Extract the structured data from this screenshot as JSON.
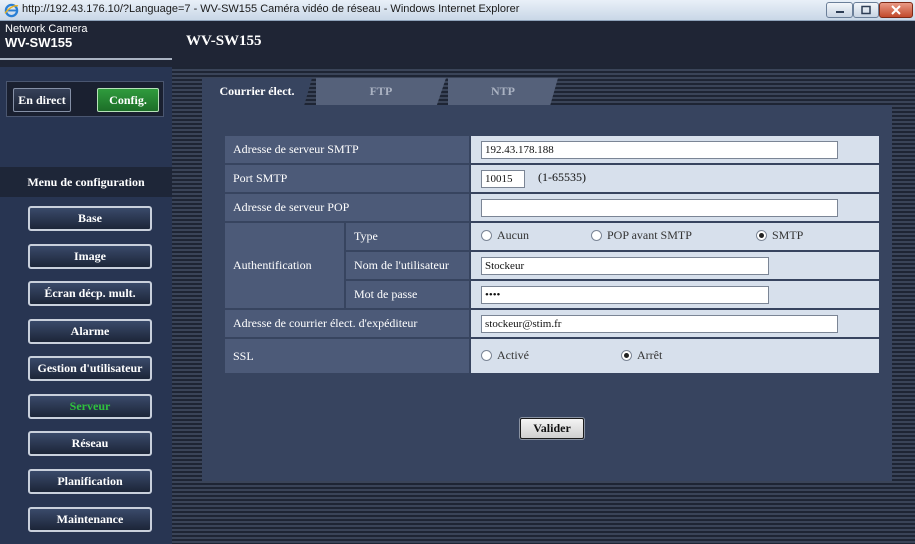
{
  "window": {
    "title": "http://192.43.176.10/?Language=7 - WV-SW155 Caméra vidéo de réseau - Windows Internet Explorer",
    "icons": [
      "ie-icon",
      "minimize-icon",
      "maximize-icon",
      "close-icon"
    ]
  },
  "header": {
    "brand_top": "Network Camera",
    "brand_model": "WV-SW155",
    "page_model": "WV-SW155"
  },
  "modes": {
    "live": "En direct",
    "config": "Config."
  },
  "menu": {
    "title": "Menu de configuration",
    "items": [
      {
        "label": "Base",
        "active": false
      },
      {
        "label": "Image",
        "active": false
      },
      {
        "label": "Écran décp. mult.",
        "active": false
      },
      {
        "label": "Alarme",
        "active": false
      },
      {
        "label": "Gestion d'utilisateur",
        "active": false
      },
      {
        "label": "Serveur",
        "active": true
      },
      {
        "label": "Réseau",
        "active": false
      },
      {
        "label": "Planification",
        "active": false
      },
      {
        "label": "Maintenance",
        "active": false
      }
    ]
  },
  "tabs": [
    {
      "label": "Courrier élect.",
      "active": true
    },
    {
      "label": "FTP",
      "active": false
    },
    {
      "label": "NTP",
      "active": false
    }
  ],
  "form": {
    "smtp_server_label": "Adresse de serveur SMTP",
    "smtp_server_value": "192.43.178.188",
    "smtp_port_label": "Port SMTP",
    "smtp_port_value": "10015",
    "smtp_port_hint": "(1-65535)",
    "pop_server_label": "Adresse de serveur POP",
    "pop_server_value": "",
    "auth_label": "Authentification",
    "auth_type_label": "Type",
    "auth_type_options": [
      "Aucun",
      "POP avant SMTP",
      "SMTP"
    ],
    "auth_type_selected": "SMTP",
    "username_label": "Nom de l'utilisateur",
    "username_value": "Stockeur",
    "password_label": "Mot de passe",
    "password_value": "••••",
    "sender_label": "Adresse de courrier élect. d'expéditeur",
    "sender_value": "stockeur@stim.fr",
    "ssl_label": "SSL",
    "ssl_options": [
      "Activé",
      "Arrêt"
    ],
    "ssl_selected": "Arrêt",
    "submit_label": "Valider"
  },
  "colors": {
    "active_menu": "#2fc23d",
    "config_button": "#2f9b3d",
    "panel": "#37445f"
  }
}
